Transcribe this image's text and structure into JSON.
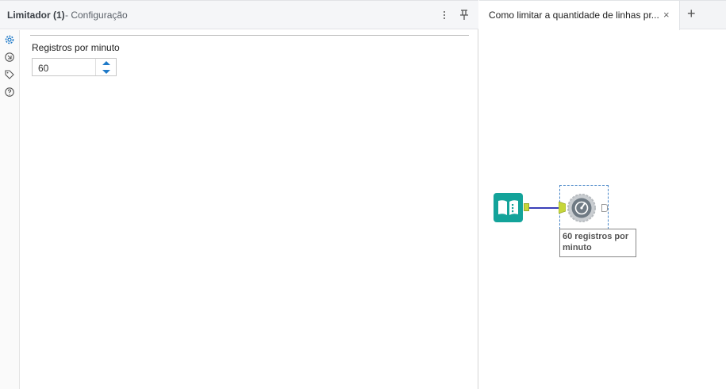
{
  "config_panel": {
    "title": "Limitador (1)",
    "subtitle": "- Configuração",
    "field_label": "Registros por minuto",
    "field_value": "60"
  },
  "side_icons": [
    "gear-icon",
    "connection-icon",
    "tag-icon",
    "help-icon"
  ],
  "canvas_panel": {
    "tab_label": "Como limitar a quantidade de linhas pr...",
    "tab_close": "×",
    "tab_add": "+",
    "annotation": "60 registros por minuto"
  },
  "colors": {
    "input_tool": "#13a39a",
    "anchor": "#c6d63a",
    "connector": "#3a3fb8",
    "selection": "#4a87c8",
    "active_side_icon": "#1f7ac8"
  }
}
